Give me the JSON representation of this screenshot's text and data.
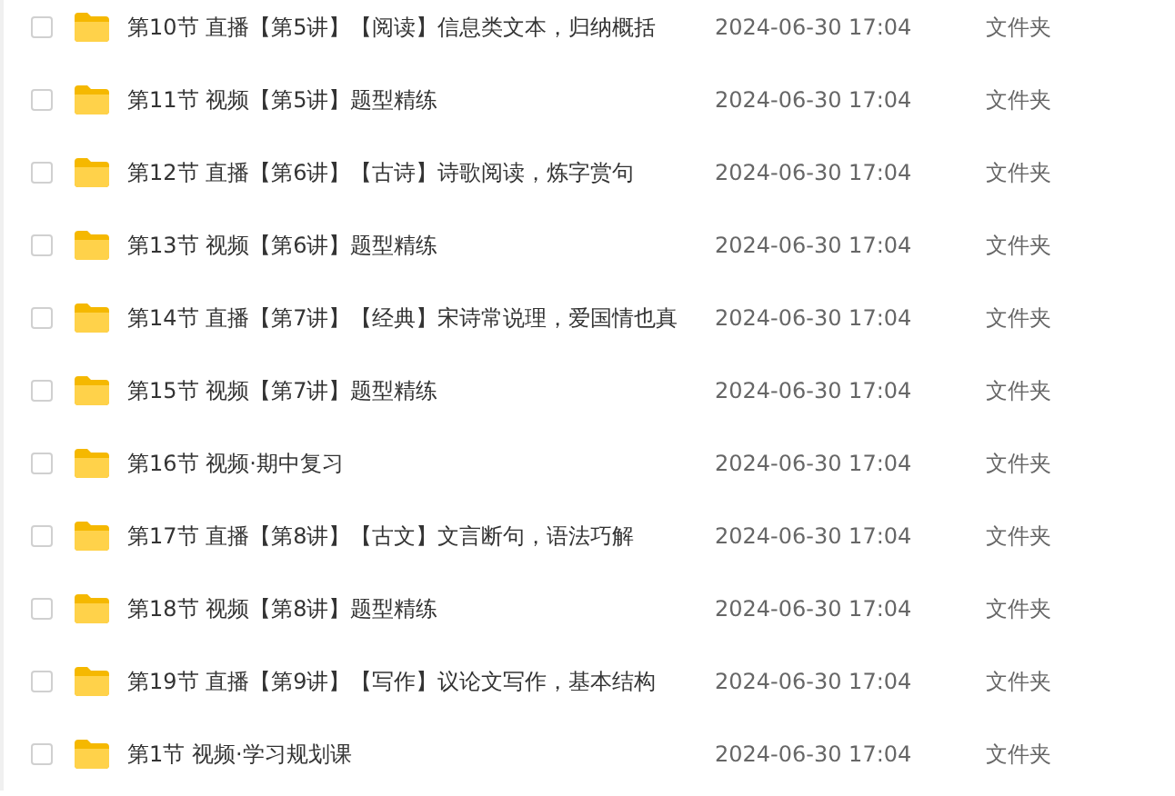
{
  "files": [
    {
      "name": "第10节 直播【第5讲】【阅读】信息类文本，归纳概括",
      "date": "2024-06-30 17:04",
      "type": "文件夹",
      "checked": false
    },
    {
      "name": "第11节 视频【第5讲】题型精练",
      "date": "2024-06-30 17:04",
      "type": "文件夹",
      "checked": false
    },
    {
      "name": "第12节 直播【第6讲】【古诗】诗歌阅读，炼字赏句",
      "date": "2024-06-30 17:04",
      "type": "文件夹",
      "checked": false
    },
    {
      "name": "第13节 视频【第6讲】题型精练",
      "date": "2024-06-30 17:04",
      "type": "文件夹",
      "checked": false
    },
    {
      "name": "第14节 直播【第7讲】【经典】宋诗常说理，爱国情也真",
      "date": "2024-06-30 17:04",
      "type": "文件夹",
      "checked": false
    },
    {
      "name": "第15节 视频【第7讲】题型精练",
      "date": "2024-06-30 17:04",
      "type": "文件夹",
      "checked": false
    },
    {
      "name": "第16节 视频·期中复习",
      "date": "2024-06-30 17:04",
      "type": "文件夹",
      "checked": false
    },
    {
      "name": "第17节 直播【第8讲】【古文】文言断句，语法巧解",
      "date": "2024-06-30 17:04",
      "type": "文件夹",
      "checked": false
    },
    {
      "name": "第18节 视频【第8讲】题型精练",
      "date": "2024-06-30 17:04",
      "type": "文件夹",
      "checked": false
    },
    {
      "name": "第19节 直播【第9讲】【写作】议论文写作，基本结构",
      "date": "2024-06-30 17:04",
      "type": "文件夹",
      "checked": false
    },
    {
      "name": "第1节 视频·学习规划课",
      "date": "2024-06-30 17:04",
      "type": "文件夹",
      "checked": false
    }
  ]
}
